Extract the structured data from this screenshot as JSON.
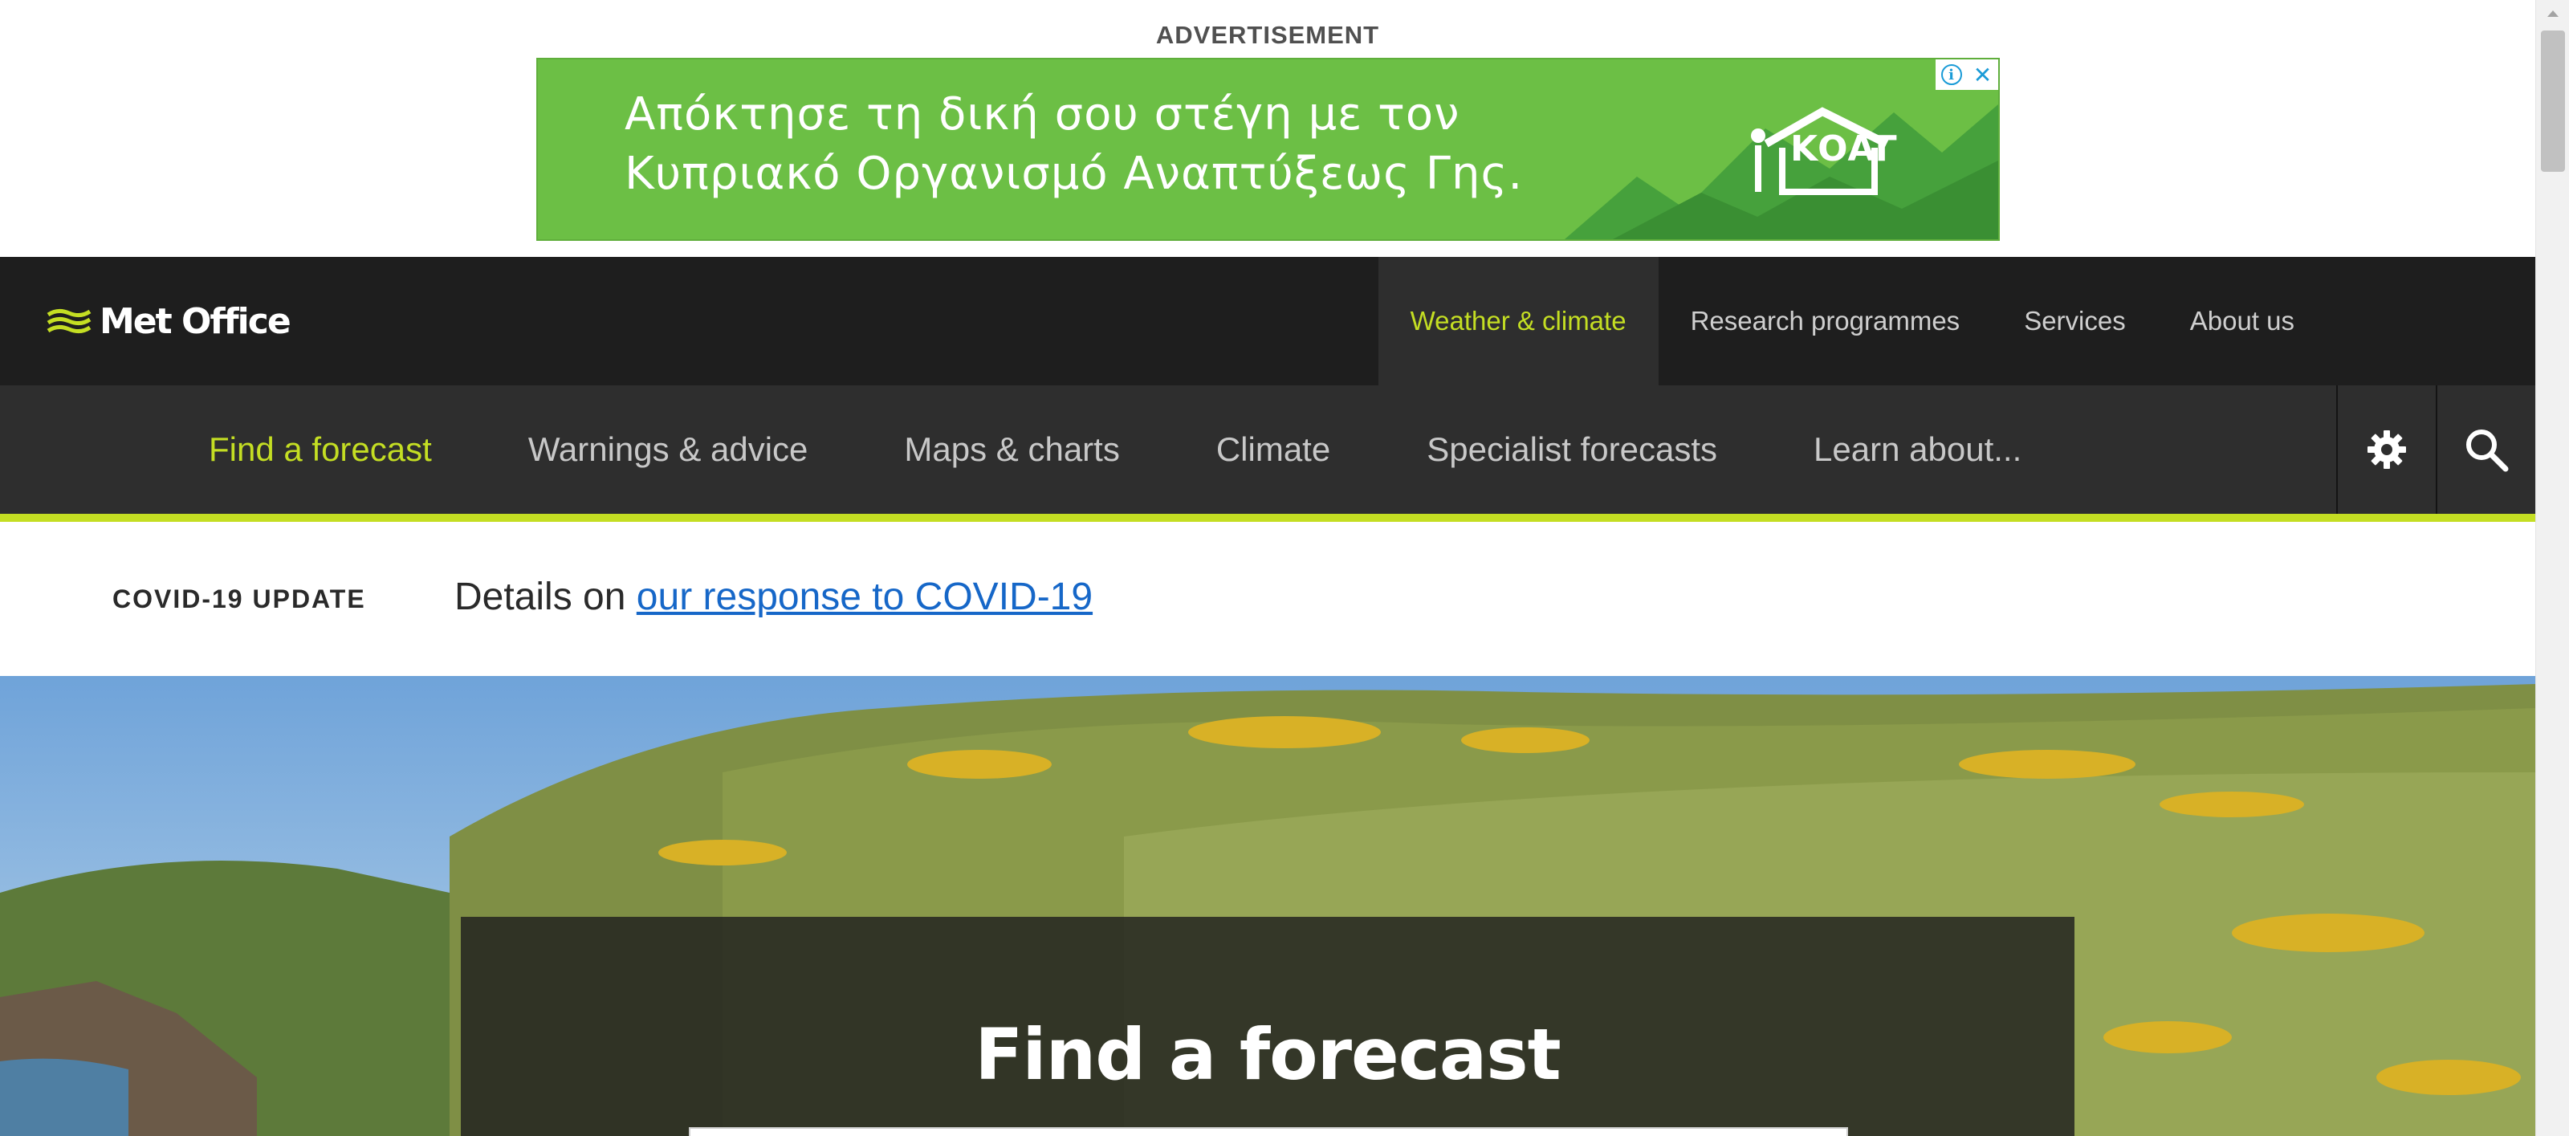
{
  "ad": {
    "label": "ADVERTISEMENT",
    "line1": "Απόκτησε τη δική σου στέγη με τον",
    "line2": "Κυπριακό Οργανισμό Αναπτύξεως Γης.",
    "brand": "ΚΟΑΓ",
    "info_icon": "i",
    "close_icon": "✕",
    "colors": {
      "background": "#6cbf45",
      "text": "#ffffff",
      "controls": "#1a9bd7"
    }
  },
  "header": {
    "logo_text": "Met Office",
    "top_nav": [
      {
        "label": "Weather & climate",
        "active": true
      },
      {
        "label": "Research programmes",
        "active": false
      },
      {
        "label": "Services",
        "active": false
      },
      {
        "label": "About us",
        "active": false
      }
    ],
    "sub_nav": [
      {
        "label": "Find a forecast",
        "active": true
      },
      {
        "label": "Warnings & advice",
        "active": false
      },
      {
        "label": "Maps & charts",
        "active": false
      },
      {
        "label": "Climate",
        "active": false
      },
      {
        "label": "Specialist forecasts",
        "active": false
      },
      {
        "label": "Learn about...",
        "active": false
      }
    ],
    "tools": [
      "gear-icon",
      "search-icon"
    ],
    "colors": {
      "top_bg": "#1e1e1e",
      "sub_bg": "#2e2e2e",
      "accent": "#c4de23"
    }
  },
  "covid": {
    "label": "COVID-19 UPDATE",
    "prefix": "Details on",
    "link_text": "our response to COVID-19",
    "link_color": "#1667c8"
  },
  "hero": {
    "title": "Find a forecast"
  }
}
